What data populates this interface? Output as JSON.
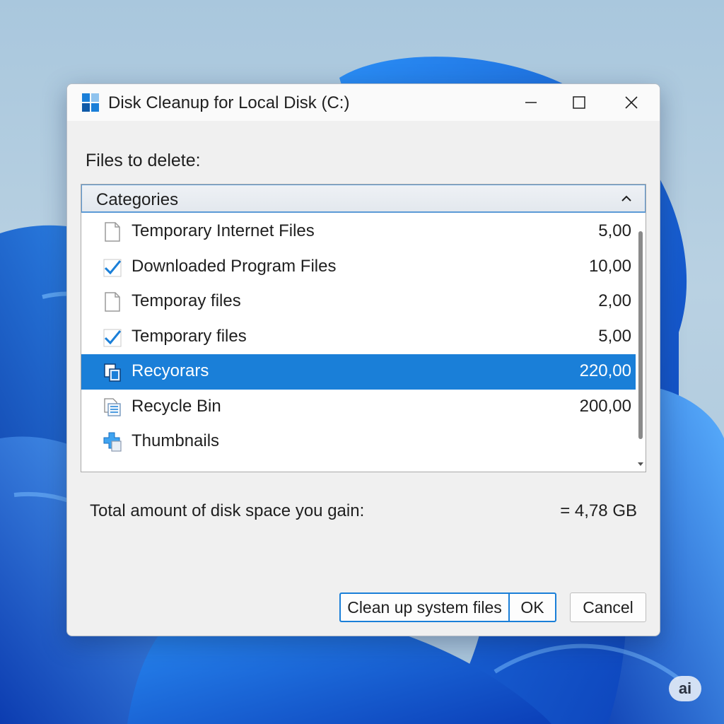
{
  "window": {
    "title": "Disk Cleanup for Local Disk (C:)",
    "icon": "disk-cleanup-icon"
  },
  "files_to_delete_label": "Files to delete:",
  "list": {
    "header": "Categories",
    "items": [
      {
        "name": "Temporary Internet Files",
        "size": "5,00",
        "checked": false,
        "icon": "document-icon",
        "selected": false
      },
      {
        "name": "Downloaded Program Files",
        "size": "10,00",
        "checked": true,
        "icon": "checkmark-icon",
        "selected": false
      },
      {
        "name": "Temporay files",
        "size": "2,00",
        "checked": false,
        "icon": "document-icon",
        "selected": false
      },
      {
        "name": "Temporary files",
        "size": "5,00",
        "checked": true,
        "icon": "checkmark-icon",
        "selected": false
      },
      {
        "name": "Recyorars",
        "size": "220,00",
        "checked": false,
        "icon": "copy-files-icon",
        "selected": true
      },
      {
        "name": "Recycle Bin",
        "size": "200,00",
        "checked": false,
        "icon": "recycle-bin-icon",
        "selected": false
      },
      {
        "name": "Thumbnails",
        "size": "",
        "checked": false,
        "icon": "thumbnails-icon",
        "selected": false
      }
    ]
  },
  "total": {
    "label": "Total amount of disk space you gain:",
    "value": "= 4,78 GB"
  },
  "buttons": {
    "cleanup": "Clean up system files",
    "ok": "OK",
    "cancel": "Cancel"
  },
  "badge": "ai",
  "colors": {
    "accent": "#1a7fd8",
    "wallpaper_blue": "#1f6fe8"
  }
}
